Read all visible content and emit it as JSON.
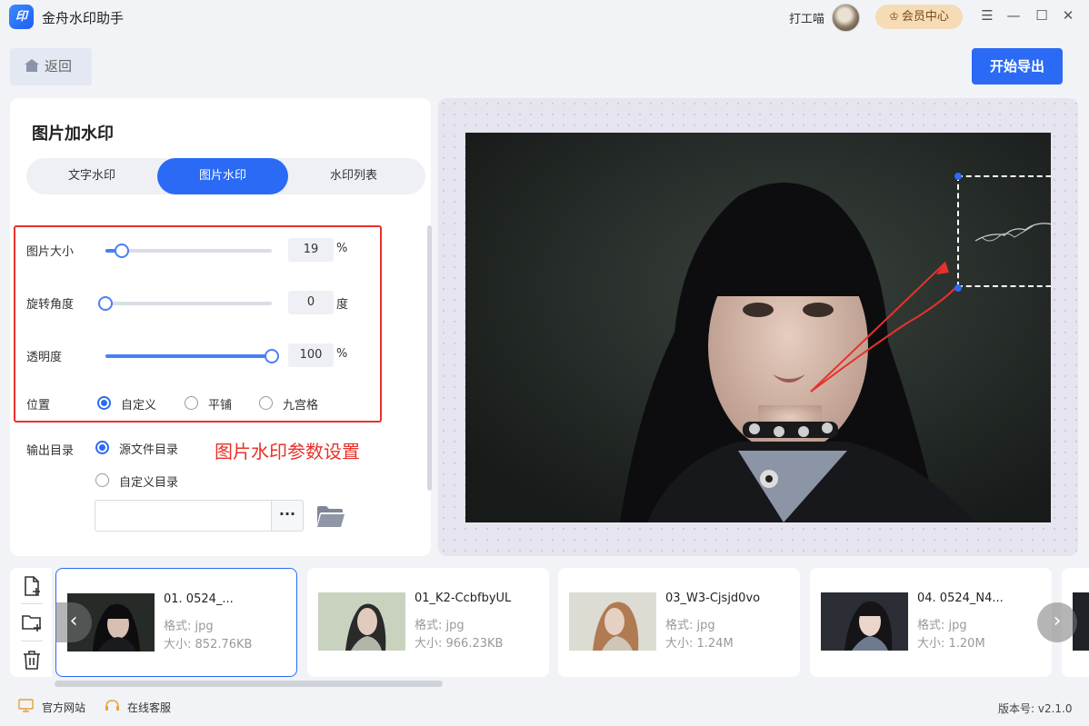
{
  "app": {
    "logo_text": "印",
    "title": "金舟水印助手",
    "user_name": "打工喵",
    "vip_label": "会员中心",
    "window_controls": [
      "☰",
      "—",
      "☐",
      "✕"
    ]
  },
  "toolbar": {
    "back_label": "返回",
    "export_label": "开始导出"
  },
  "panel": {
    "title": "图片加水印",
    "tabs": [
      {
        "label": "文字水印",
        "active": false
      },
      {
        "label": "图片水印",
        "active": true
      },
      {
        "label": "水印列表",
        "active": false
      }
    ],
    "size": {
      "label": "图片大小",
      "value": "19",
      "unit": "%",
      "fraction": 0.1
    },
    "rotation": {
      "label": "旋转角度",
      "value": "0",
      "unit": "度",
      "fraction": 0.0
    },
    "opacity": {
      "label": "透明度",
      "value": "100",
      "unit": "%",
      "fraction": 1.0
    },
    "position": {
      "label": "位置",
      "options": [
        "自定义",
        "平铺",
        "九宫格"
      ],
      "selected": "自定义"
    },
    "annotation": "图片水印参数设置",
    "output": {
      "label": "输出目录",
      "options": [
        "源文件目录",
        "自定义目录"
      ],
      "selected": "源文件目录",
      "path_value": "",
      "more_label": "···"
    }
  },
  "preview": {
    "watermark_close": "×"
  },
  "files": [
    {
      "name": "01. 0524_...",
      "format": "格式: jpg",
      "size": "大小: 852.76KB",
      "selected": true
    },
    {
      "name": "01_K2-CcbfbyUL",
      "format": "格式: jpg",
      "size": "大小: 966.23KB",
      "selected": false
    },
    {
      "name": "03_W3-Cjsjd0vo",
      "format": "格式: jpg",
      "size": "大小: 1.24M",
      "selected": false
    },
    {
      "name": "04. 0524_N4...",
      "format": "格式: jpg",
      "size": "大小: 1.20M",
      "selected": false
    }
  ],
  "footer": {
    "website": "官方网站",
    "support": "在线客服",
    "version": "版本号: v2.1.0"
  },
  "colors": {
    "accent": "#2a6af5",
    "annotation_red": "#e8312b",
    "vip_bg": "#f5dcb6"
  }
}
